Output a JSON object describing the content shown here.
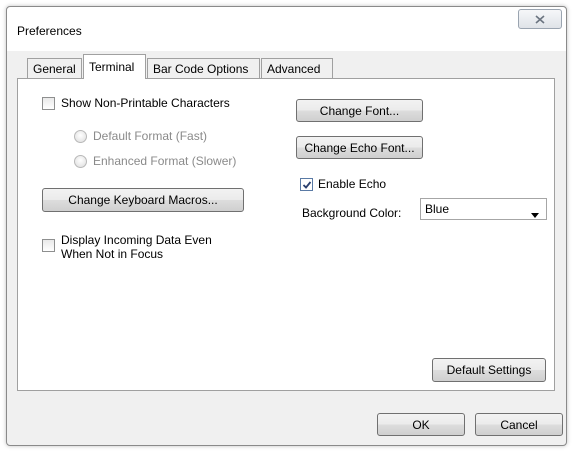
{
  "window": {
    "title": "Preferences"
  },
  "tabs": [
    {
      "label": "General",
      "active": false
    },
    {
      "label": "Terminal",
      "active": true
    },
    {
      "label": "Bar Code Options",
      "active": false
    },
    {
      "label": "Advanced",
      "active": false
    }
  ],
  "terminal": {
    "show_nonprintable": {
      "label": "Show Non-Printable Characters",
      "checked": false
    },
    "format_default": {
      "label": "Default Format (Fast)",
      "enabled": false
    },
    "format_enhanced": {
      "label": "Enhanced Format (Slower)",
      "enabled": false
    },
    "keyboard_macros_button": "Change Keyboard Macros...",
    "display_incoming": {
      "label_line1": "Display Incoming Data Even",
      "label_line2": "When Not in Focus",
      "checked": false
    },
    "change_font_button": "Change Font...",
    "change_echo_font_button": "Change Echo Font...",
    "enable_echo": {
      "label": "Enable Echo",
      "checked": true
    },
    "background_color": {
      "label": "Background Color:",
      "value": "Blue"
    },
    "default_settings_button": "Default Settings"
  },
  "footer": {
    "ok_label": "OK",
    "cancel_label": "Cancel"
  }
}
